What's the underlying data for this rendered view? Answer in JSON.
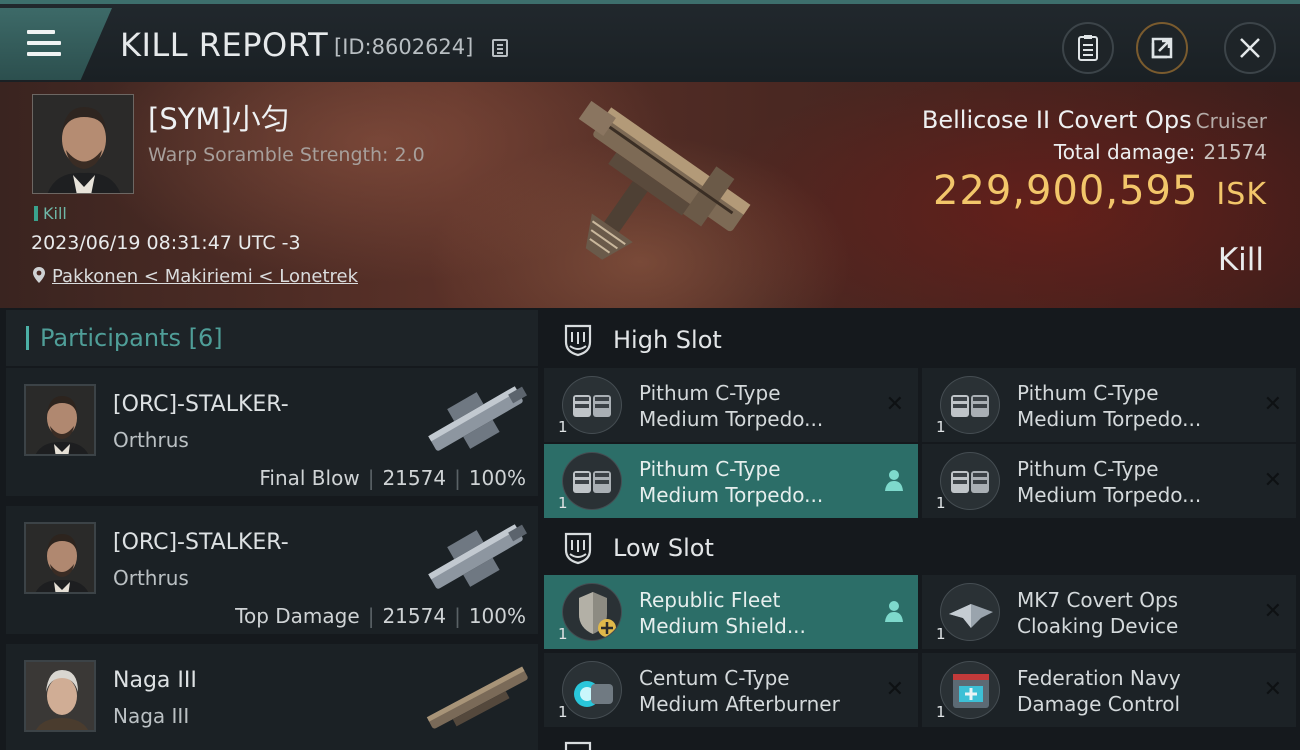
{
  "header": {
    "title": "KILL REPORT",
    "report_id": "[ID:8602624]"
  },
  "victim": {
    "name": "[SYM]小匀",
    "scramble": "Warp Soramble Strength: 2.0",
    "tag": "Kill",
    "datetime": "2023/06/19 08:31:47 UTC -3",
    "location": "Pakkonen < Makiriemi < Lonetrek",
    "ship": "Bellicose II Covert Ops",
    "ship_class": "Cruiser",
    "total_damage_label": "Total damage:",
    "total_damage": "21574",
    "isk_value": "229,900,595",
    "isk_unit": "ISK",
    "result": "Kill"
  },
  "participants": {
    "title": "Participants",
    "count": "[6]",
    "items": [
      {
        "name": "[ORC]-STALKER-",
        "ship": "Orthrus",
        "role": "Final Blow",
        "damage": "21574",
        "percent": "100%"
      },
      {
        "name": "[ORC]-STALKER-",
        "ship": "Orthrus",
        "role": "Top Damage",
        "damage": "21574",
        "percent": "100%"
      },
      {
        "name": "Naga III",
        "ship": "Naga III"
      }
    ]
  },
  "fitting": {
    "high_slot": {
      "label": "High Slot",
      "modules": [
        {
          "line1": "Pithum C-Type",
          "line2": "Medium Torpedo...",
          "qty": "1"
        },
        {
          "line1": "Pithum C-Type",
          "line2": "Medium Torpedo...",
          "qty": "1"
        },
        {
          "line1": "Pithum C-Type",
          "line2": "Medium Torpedo...",
          "qty": "1"
        },
        {
          "line1": "Pithum C-Type",
          "line2": "Medium Torpedo...",
          "qty": "1"
        }
      ]
    },
    "low_slot": {
      "label": "Low Slot",
      "modules": [
        {
          "line1": "Republic Fleet",
          "line2": "Medium Shield...",
          "qty": "1"
        },
        {
          "line1": "MK7 Covert Ops",
          "line2": "Cloaking Device",
          "qty": "1"
        },
        {
          "line1": "Centum C-Type",
          "line2": "Medium Afterburner",
          "qty": "1"
        },
        {
          "line1": "Federation Navy",
          "line2": "Damage Control",
          "qty": "1"
        }
      ]
    }
  },
  "colors": {
    "accent_teal": "#3aa28d",
    "highlight_row": "#2c6e68",
    "isk_gold": "#f2c66a"
  }
}
